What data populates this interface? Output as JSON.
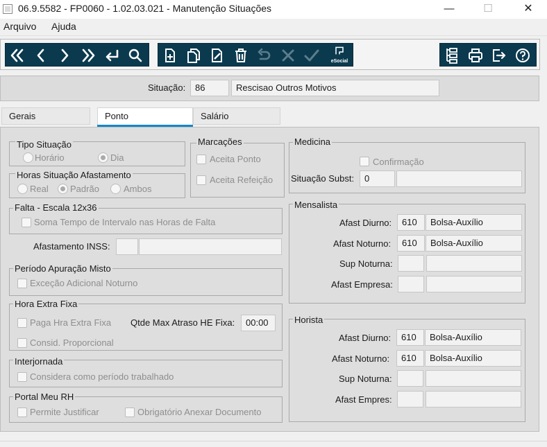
{
  "window": {
    "title": "06.9.5582 - FP0060 - 1.02.03.021 - Manutenção Situações",
    "minimize": "—",
    "maximize": "☐",
    "close": "✕"
  },
  "menu": {
    "file": "Arquivo",
    "help": "Ajuda"
  },
  "toolbar": {
    "nav_icons": [
      "first-icon",
      "previous-icon",
      "next-icon",
      "last-icon",
      "goto-icon",
      "search-icon"
    ],
    "edit_icons": [
      "add-icon",
      "copy-icon",
      "edit-icon",
      "delete-icon",
      "undo-icon",
      "cancel-icon",
      "confirm-icon"
    ],
    "esocial_label": "eSocial",
    "right_icons": [
      "tree-icon",
      "print-icon",
      "exit-icon",
      "help-icon"
    ],
    "accent_color": "#0b3a4f"
  },
  "situation": {
    "label": "Situação:",
    "code": "86",
    "description": "Rescisao Outros Motivos"
  },
  "tabs": [
    {
      "label": "Gerais"
    },
    {
      "label": "Ponto"
    },
    {
      "label": "Salário"
    }
  ],
  "active_tab": "Ponto",
  "ponto": {
    "tipo_situacao": {
      "title": "Tipo Situação",
      "opt_horario": "Horário",
      "opt_dia": "Dia",
      "selected": "Dia"
    },
    "horas_afastamento": {
      "title": "Horas Situação Afastamento",
      "opt_real": "Real",
      "opt_padrao": "Padrão",
      "opt_ambos": "Ambos",
      "selected": "Padrão"
    },
    "marcacoes": {
      "title": "Marcações",
      "aceita_ponto": "Aceita Ponto",
      "aceita_refeicao": "Aceita Refeição"
    },
    "falta": {
      "title": "Falta - Escala 12x36",
      "soma_tempo": "Soma Tempo de Intervalo nas Horas de Falta"
    },
    "afastamento_inss": {
      "label": "Afastamento INSS:",
      "code": "",
      "description": ""
    },
    "periodo_apuracao": {
      "title": "Período Apuração Misto",
      "excecao": "Exceção Adicional Noturno"
    },
    "hora_extra": {
      "title": "Hora Extra Fixa",
      "paga": "Paga Hra Extra Fixa",
      "consid": "Consid. Proporcional",
      "qtde_label": "Qtde Max Atraso HE Fixa:",
      "qtde_value": "00:00"
    },
    "interjornada": {
      "title": "Interjornada",
      "considera": "Considera como período trabalhado"
    },
    "portal": {
      "title": "Portal Meu RH",
      "permite": "Permite Justificar",
      "obrigatorio": "Obrigatório Anexar Documento"
    },
    "medicina": {
      "title": "Medicina",
      "confirmacao": "Confirmação",
      "sit_subst_label": "Situação Subst:",
      "sit_subst_code": "0",
      "sit_subst_desc": ""
    },
    "mensalista": {
      "title": "Mensalista",
      "diurno_label": "Afast Diurno:",
      "diurno_code": "610",
      "diurno_desc": "Bolsa-Auxílio",
      "noturno_label": "Afast Noturno:",
      "noturno_code": "610",
      "noturno_desc": "Bolsa-Auxílio",
      "sup_label": "Sup Noturna:",
      "sup_code": "",
      "sup_desc": "",
      "empresa_label": "Afast Empresa:",
      "empresa_code": "",
      "empresa_desc": ""
    },
    "horista": {
      "title": "Horista",
      "diurno_label": "Afast Diurno:",
      "diurno_code": "610",
      "diurno_desc": "Bolsa-Auxílio",
      "noturno_label": "Afast Noturno:",
      "noturno_code": "610",
      "noturno_desc": "Bolsa-Auxílio",
      "sup_label": "Sup Noturna:",
      "sup_code": "",
      "sup_desc": "",
      "empresa_label": "Afast Empres:",
      "empresa_code": "",
      "empresa_desc": ""
    }
  }
}
